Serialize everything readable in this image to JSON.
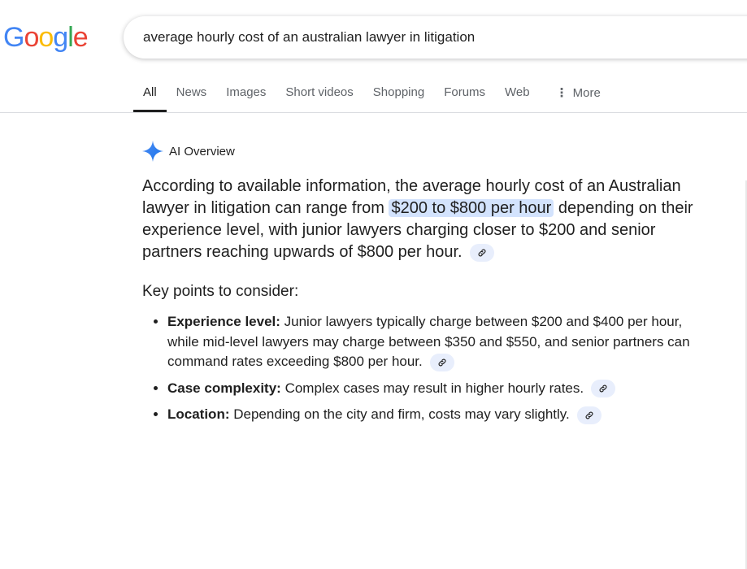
{
  "logo": {
    "letters": [
      "G",
      "o",
      "o",
      "g",
      "l",
      "e"
    ],
    "colors": [
      "#4285F4",
      "#EA4335",
      "#FBBC05",
      "#4285F4",
      "#34A853",
      "#EA4335"
    ]
  },
  "search": {
    "value": "average hourly cost of an australian lawyer in litigation"
  },
  "tabs": [
    {
      "label": "All",
      "active": true
    },
    {
      "label": "News"
    },
    {
      "label": "Images"
    },
    {
      "label": "Short videos"
    },
    {
      "label": "Shopping"
    },
    {
      "label": "Forums"
    },
    {
      "label": "Web"
    },
    {
      "label": "More",
      "icon": "more-vert-icon"
    }
  ],
  "ai_overview": {
    "label": "AI Overview",
    "icon": "gemini-sparkle-icon",
    "accent": "#4285F4",
    "lead_before": "According to available information, the average hourly cost of an Australian lawyer in litigation can range from ",
    "lead_highlight": "$200 to $800 per hour",
    "lead_after": " depending on their experience level, with junior lawyers charging closer to $200 and senior partners reaching upwards of $800 per hour.",
    "key_points_title": "Key points to consider:",
    "points": [
      {
        "title": "Experience level:",
        "text": " Junior lawyers typically charge between $200 and $400 per hour, while mid-level lawyers may charge between $350 and $550, and senior partners can command rates exceeding $800 per hour."
      },
      {
        "title": "Case complexity:",
        "text": " Complex cases may result in higher hourly rates."
      },
      {
        "title": "Location:",
        "text": " Depending on the city and firm, costs may vary slightly."
      }
    ],
    "link_icon": "link-icon"
  }
}
